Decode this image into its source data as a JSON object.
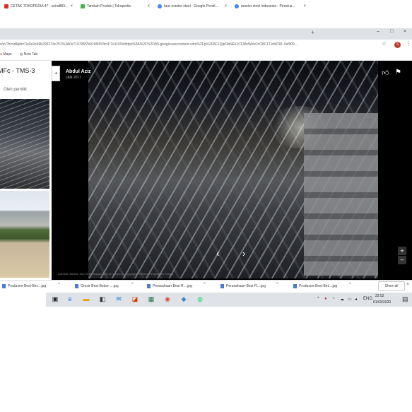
{
  "tabs": [
    {
      "label": "CETAK TOKOPEDIA 47 - seira883...",
      "color": "#d93025"
    },
    {
      "label": "Tambah Produk | Tokopedia",
      "color": "#42b549"
    },
    {
      "label": "besi master steel - Google Penel...",
      "color": "#4285f4"
    },
    {
      "label": "master steel indonesia - Penelus...",
      "color": "#4285f4"
    }
  ],
  "new_tab_icon": "plus-icon",
  "window_controls": [
    "–",
    "□",
    "×"
  ],
  "address_bar": {
    "url": "s/sv?hl=id&pb=!1s0x2e69b295274c251%3A0x710795f7b916f4f3!3m1!7e115!4shttps%3A%2F%2Flh5.googleusercontent.com%2Fp%2FAF1QipObNEk1CFMnWeixJcO8C1TurttZ3f1-9xf909..."
  },
  "profile_initial": "S",
  "bookmarks": [
    {
      "label": "Maps"
    },
    {
      "label": "New Tab"
    }
  ],
  "place": {
    "title": "MFc - TMS-3",
    "owner_label": "Oleh pemilik"
  },
  "photo": {
    "author": "Abdul Aziz",
    "date": "JAN 2017",
    "credits": "Gambar diambil: Sep 2016    Images may be subject to copyright.    ©Pixtea    Pengaturan    Privasi"
  },
  "downloads": [
    {
      "name": "Produsen-Besi-Bet....jpg"
    },
    {
      "name": "Grosir-Besi-Betoe-....jpg"
    },
    {
      "name": "Perusahaan-Besi-R....jpg"
    },
    {
      "name": "Perusahaan-Besi-R....jpg"
    },
    {
      "name": "Produsen-Besi-Bet....jpg"
    }
  ],
  "show_all": "Show all",
  "taskbar": {
    "lang": "ENG",
    "time": "22:52",
    "date": "01/03/2020"
  }
}
